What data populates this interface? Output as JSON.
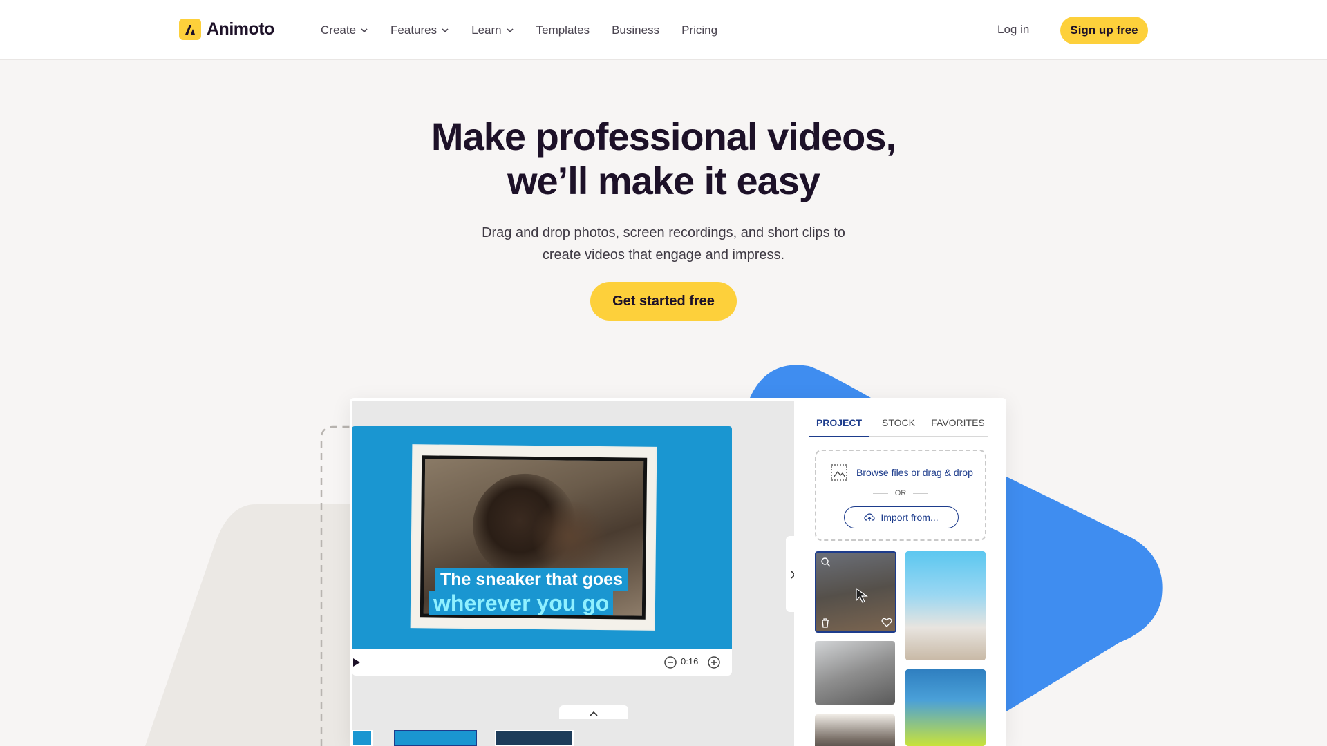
{
  "header": {
    "logo_text": "Animoto",
    "nav": [
      {
        "label": "Create",
        "has_dropdown": true
      },
      {
        "label": "Features",
        "has_dropdown": true
      },
      {
        "label": "Learn",
        "has_dropdown": true
      },
      {
        "label": "Templates",
        "has_dropdown": false
      },
      {
        "label": "Business",
        "has_dropdown": false
      },
      {
        "label": "Pricing",
        "has_dropdown": false
      }
    ],
    "login_label": "Log in",
    "signup_label": "Sign up free"
  },
  "hero": {
    "title_line1": "Make professional videos,",
    "title_line2": "we’ll make it easy",
    "subtitle_line1": "Drag and drop photos, screen recordings, and short clips to",
    "subtitle_line2": "create videos that engage and impress.",
    "cta_label": "Get started free"
  },
  "editor": {
    "caption_line1": "The sneaker that goes",
    "caption_line2": "wherever you go",
    "duration": "0:16",
    "panel": {
      "tabs": [
        {
          "label": "PROJECT",
          "active": true
        },
        {
          "label": "STOCK",
          "active": false
        },
        {
          "label": "FAVORITES",
          "active": false
        }
      ],
      "browse_label": "Browse files or drag & drop",
      "or_label": "OR",
      "import_label": "Import from..."
    }
  },
  "colors": {
    "brand_yellow": "#fdd03b",
    "stage_blue": "#1a96d1",
    "accent_blue": "#3f8df0",
    "navy": "#1d3c8c"
  },
  "icons": [
    "logo-mark-icon",
    "chevron-down-icon",
    "play-icon",
    "zoom-out-icon",
    "zoom-in-icon",
    "chevron-up-icon",
    "chevron-right-icon",
    "image-icon",
    "cloud-upload-icon",
    "magnify-icon",
    "trash-icon",
    "heart-icon",
    "cursor-icon"
  ]
}
